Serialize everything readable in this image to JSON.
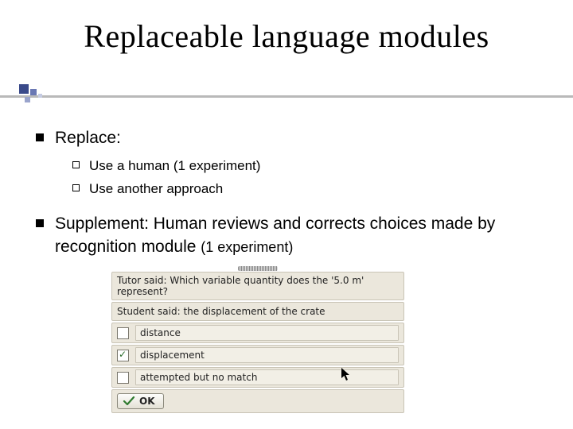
{
  "title": "Replaceable language modules",
  "bullets": {
    "replace_label": "Replace:",
    "sub": {
      "human": "Use a human (1 experiment)",
      "another": "Use another approach"
    },
    "supplement_prefix": "Supplement: Human reviews and corrects choices made by recognition module ",
    "supplement_suffix": "(1 experiment)"
  },
  "panel": {
    "tutor_line": "Tutor said: Which variable quantity does the '5.0 m' represent?",
    "student_line": "Student said: the displacement of the crate",
    "options": [
      {
        "label": "distance",
        "checked": false
      },
      {
        "label": "displacement",
        "checked": true
      },
      {
        "label": "attempted but no match",
        "checked": false
      }
    ],
    "ok_label": "OK"
  }
}
